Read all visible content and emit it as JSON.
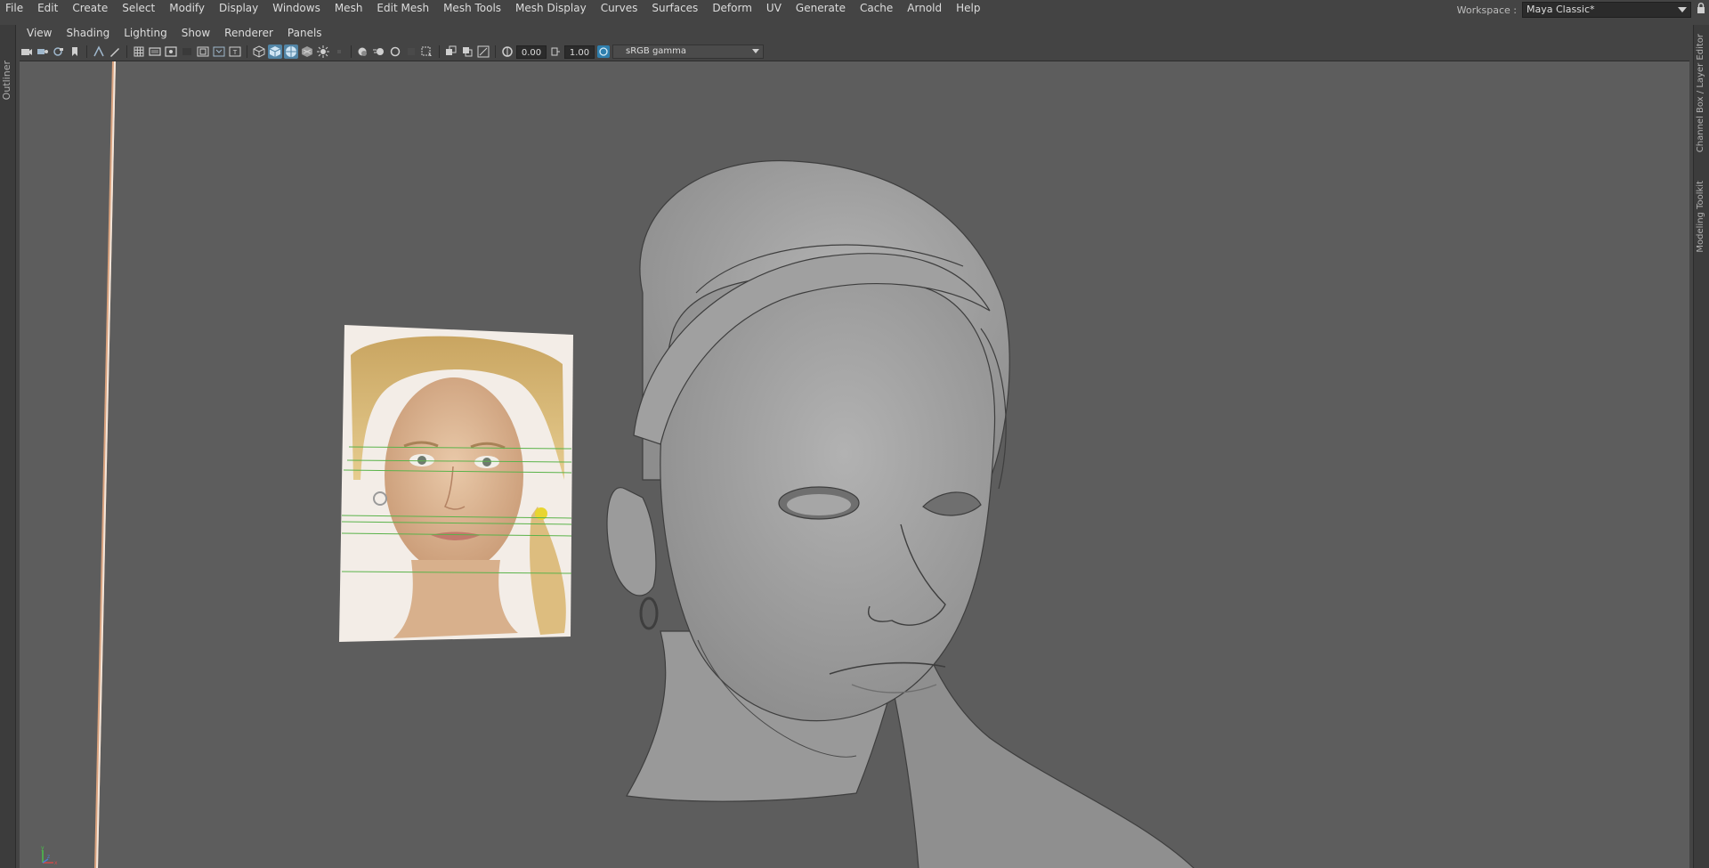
{
  "menubar": {
    "items": [
      "File",
      "Edit",
      "Create",
      "Select",
      "Modify",
      "Display",
      "Windows",
      "Mesh",
      "Edit Mesh",
      "Mesh Tools",
      "Mesh Display",
      "Curves",
      "Surfaces",
      "Deform",
      "UV",
      "Generate",
      "Cache",
      "Arnold",
      "Help"
    ]
  },
  "workspace": {
    "label": "Workspace :",
    "value": "Maya Classic*"
  },
  "left_panel": {
    "tab": "Outliner"
  },
  "right_panel": {
    "tabs": [
      "Channel Box / Layer Editor",
      "Modeling Toolkit"
    ]
  },
  "panel_menu": {
    "items": [
      "View",
      "Shading",
      "Lighting",
      "Show",
      "Renderer",
      "Panels"
    ]
  },
  "viewport_toolbar": {
    "exposure": "0.00",
    "gamma": "1.00",
    "color_space": "sRGB gamma"
  },
  "icons": {
    "lock": "lock-icon",
    "axis": "view-axis-icon"
  },
  "colors": {
    "ui_bg": "#444444",
    "viewport_bg": "#5d5d5d",
    "active_tool": "#5285a6",
    "reference_line": "#5ab34a"
  }
}
